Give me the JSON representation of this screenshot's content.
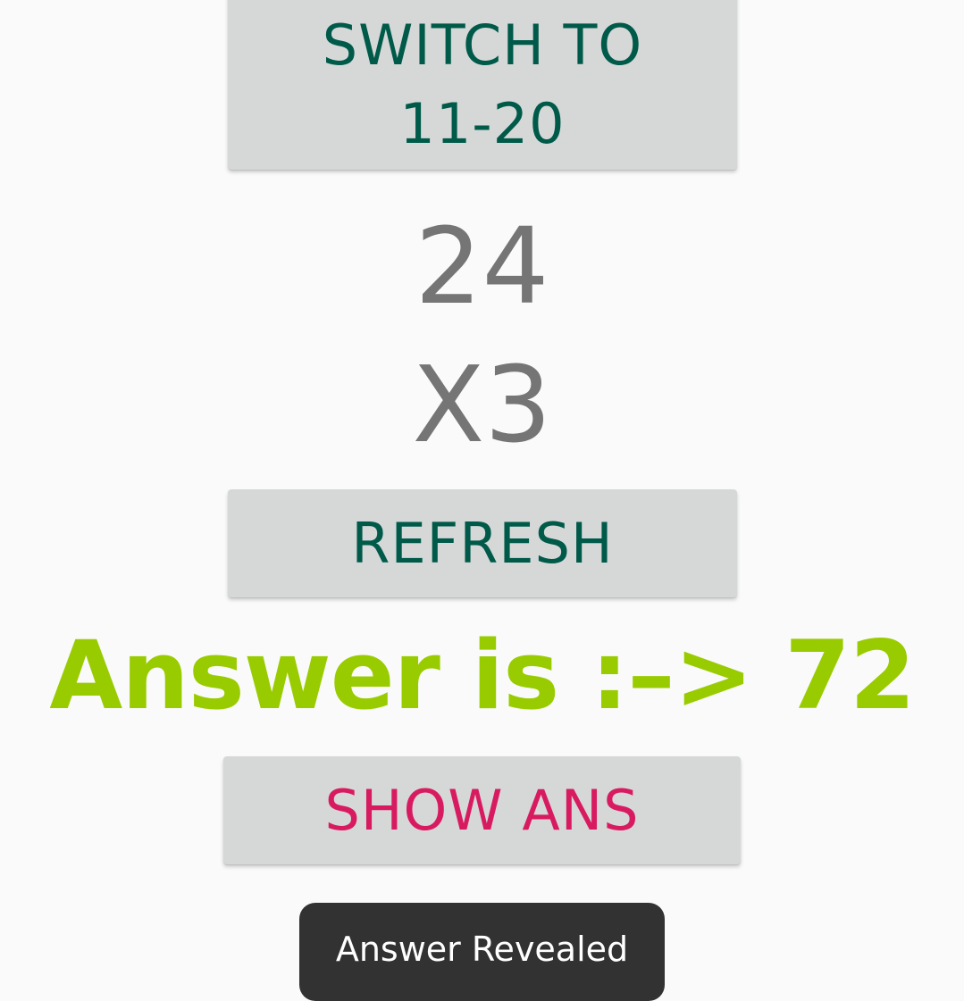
{
  "buttons": {
    "switch_label": "SWITCH TO\n11-20",
    "refresh_label": "REFRESH",
    "show_ans_label": "SHOW ANS"
  },
  "question": {
    "number": "24",
    "multiplier": "X3"
  },
  "answer": {
    "text": "Answer is :–> 72"
  },
  "toast": {
    "message": "Answer Revealed"
  },
  "colors": {
    "background": "#fafafa",
    "button_bg": "#d6d8d7",
    "button_text": "#005a49",
    "show_ans_text": "#d81b60",
    "number_text": "#757575",
    "answer_text": "#99cc00",
    "toast_bg": "#323232"
  }
}
